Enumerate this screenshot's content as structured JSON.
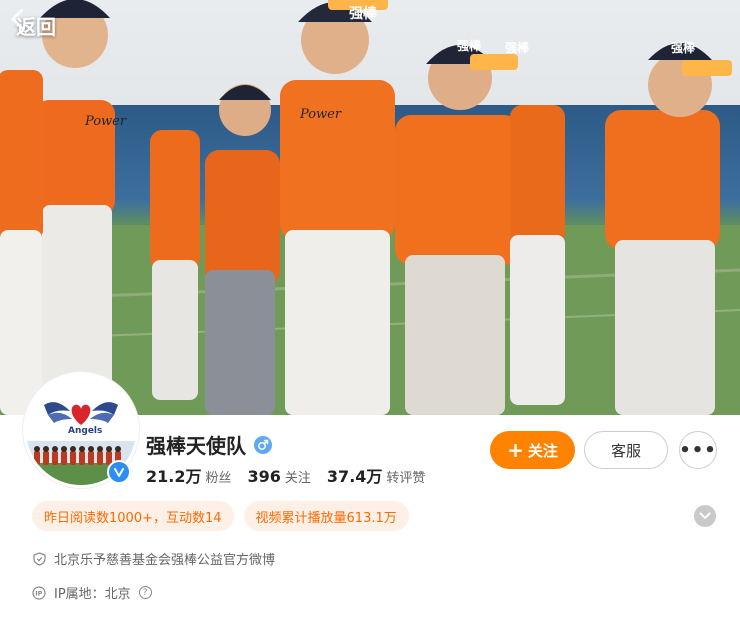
{
  "nav": {
    "back_label": "返回"
  },
  "cover": {
    "cap_text": "强棒",
    "jersey_text": "Power"
  },
  "avatar": {
    "logo_text": "Angels"
  },
  "profile": {
    "name": "强棒天使队",
    "stats": [
      {
        "value": "21.2万",
        "label": "粉丝"
      },
      {
        "value": "396",
        "label": "关注"
      },
      {
        "value": "37.4万",
        "label": "转评赞"
      }
    ]
  },
  "actions": {
    "follow_label": "关注",
    "service_label": "客服",
    "more_label": "•••"
  },
  "tags": [
    "昨日阅读数1000+，互动数14",
    "视频累计播放量613.1万"
  ],
  "info": {
    "description": "北京乐予慈善基金会强棒公益官方微博",
    "ip_location": "IP属地：北京"
  },
  "colors": {
    "accent": "#ff8200",
    "tag_bg": "#fef0e6",
    "tag_text": "#ff6a00",
    "verified": "#2b8ef0"
  }
}
